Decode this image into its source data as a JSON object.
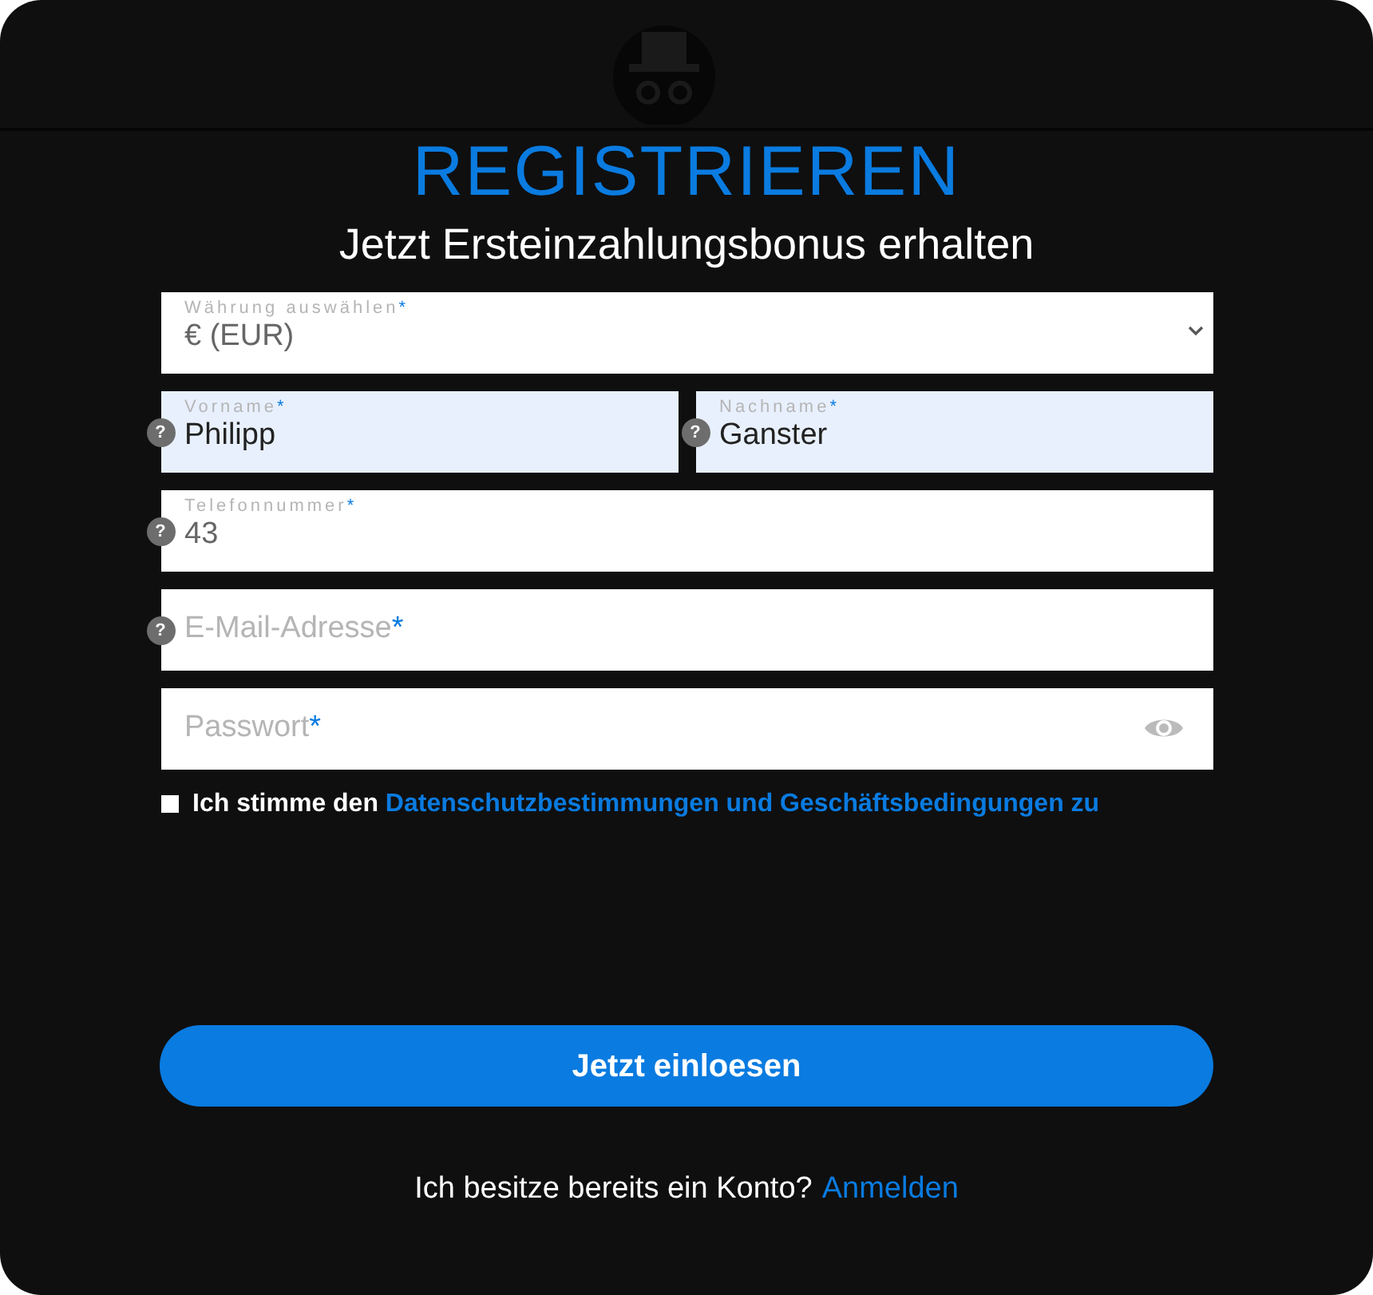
{
  "title": "REGISTRIEREN",
  "subtitle": "Jetzt Ersteinzahlungsbonus erhalten",
  "fields": [
    {
      "kind": "select",
      "label": "Währung auswählen",
      "required_mark": "*",
      "value": "€ (EUR)",
      "autofilled": false
    },
    {
      "kind": "text",
      "label": "Vorname",
      "required_mark": "*",
      "value": "Philipp",
      "help": "?",
      "autofilled": true
    },
    {
      "kind": "text",
      "label": "Nachname",
      "required_mark": "*",
      "value": "Ganster",
      "help": "?",
      "autofilled": true
    },
    {
      "kind": "text",
      "label": "Telefonnummer",
      "required_mark": "*",
      "value": "43",
      "help": "?",
      "autofilled": false
    },
    {
      "kind": "text",
      "label": "E-Mail-Adresse",
      "required_mark": "*",
      "help": "?",
      "autofilled": false
    },
    {
      "kind": "password",
      "label": "Passwort",
      "required_mark": "*",
      "autofilled": false
    }
  ],
  "consent": {
    "checked": false,
    "text": "Ich stimme den",
    "link": "Datenschutzbestimmungen und Geschäftsbedingungen zu"
  },
  "submit": "Jetzt einloesen",
  "login": {
    "text": "Ich besitze bereits ein Konto?",
    "link": "Anmelden"
  }
}
